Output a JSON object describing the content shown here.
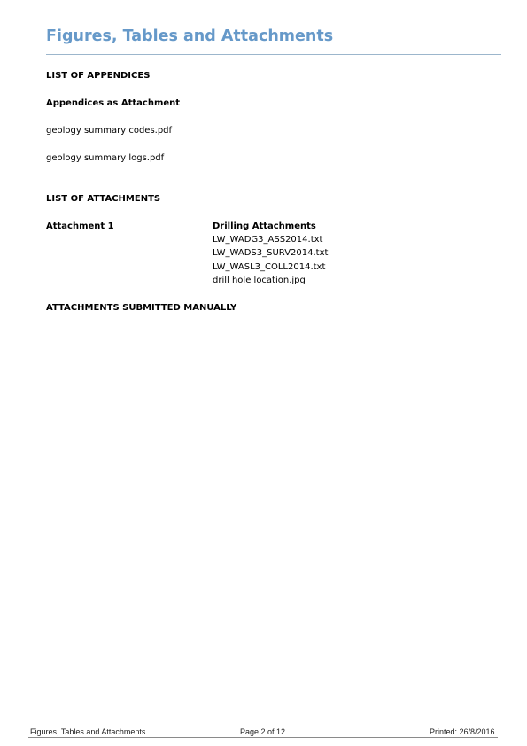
{
  "page": {
    "title": "Figures, Tables and Attachments",
    "accent_color": "#6699c9"
  },
  "appendices": {
    "heading": "LIST OF APPENDICES",
    "subheading": "Appendices as Attachment",
    "items": [
      "geology summary codes.pdf",
      "geology summary logs.pdf"
    ]
  },
  "attachments": {
    "heading": "LIST OF ATTACHMENTS",
    "entry": {
      "label": "Attachment 1",
      "title": "Drilling Attachments",
      "files": [
        "LW_WADG3_ASS2014.txt",
        "LW_WADS3_SURV2014.txt",
        "LW_WASL3_COLL2014.txt",
        "drill hole location.jpg"
      ]
    },
    "manual_heading": "ATTACHMENTS SUBMITTED MANUALLY"
  },
  "footer": {
    "left": "Figures, Tables and Attachments",
    "center": "Page 2 of 12",
    "right": "Printed: 26/8/2016"
  }
}
